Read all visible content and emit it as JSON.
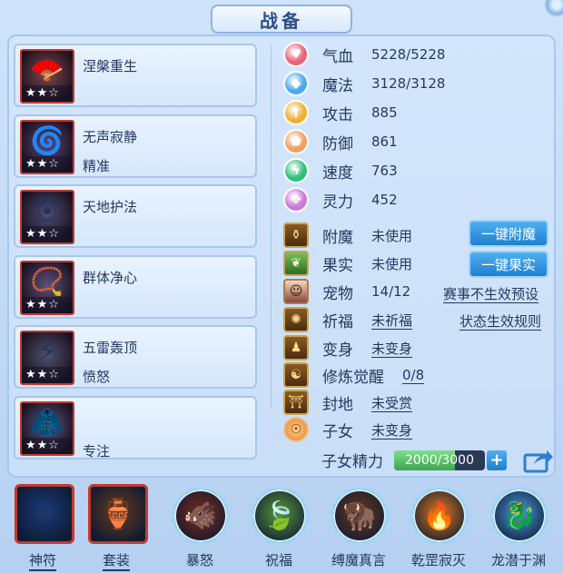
{
  "window": {
    "title": "战备"
  },
  "skills": [
    {
      "name": "涅槃重生",
      "sub": "",
      "stars": "★★☆",
      "icon": "fan-icon",
      "glyph": "🪭",
      "bg": "#6b1f1f"
    },
    {
      "name": "无声寂静",
      "sub": "精准",
      "stars": "★★☆",
      "icon": "silence-icon",
      "glyph": "🌀",
      "bg": "#3b1d4a"
    },
    {
      "name": "天地护法",
      "sub": "",
      "stars": "★★☆",
      "icon": "guardian-icon",
      "glyph": "👁",
      "bg": "#2f2450"
    },
    {
      "name": "群体净心",
      "sub": "",
      "stars": "★★☆",
      "icon": "purify-icon",
      "glyph": "📿",
      "bg": "#3a2a55"
    },
    {
      "name": "五雷轰顶",
      "sub": "愤怒",
      "stars": "★★☆",
      "icon": "thunder-icon",
      "glyph": "⚡",
      "bg": "#2a2a48"
    },
    {
      "name": "",
      "sub": "专注",
      "stars": "★★☆",
      "icon": "focus-icon",
      "glyph": "🧥",
      "bg": "#3a3168"
    }
  ],
  "stats": [
    {
      "label": "气血",
      "value": "5228/5228",
      "icon": "heart-icon",
      "glyph": "♥",
      "color": "#e8627a"
    },
    {
      "label": "魔法",
      "value": "3128/3128",
      "icon": "mana-icon",
      "glyph": "◆",
      "color": "#4aa8f0"
    },
    {
      "label": "攻击",
      "value": "885",
      "icon": "attack-icon",
      "glyph": "†",
      "color": "#f0b030"
    },
    {
      "label": "防御",
      "value": "861",
      "icon": "defense-icon",
      "glyph": "⬟",
      "color": "#f0a060"
    },
    {
      "label": "速度",
      "value": "763",
      "icon": "speed-icon",
      "glyph": "ϟ",
      "color": "#2ec07a"
    },
    {
      "label": "灵力",
      "value": "452",
      "icon": "spirit-icon",
      "glyph": "✥",
      "color": "#c77ad8"
    }
  ],
  "buffs": [
    {
      "label": "附魔",
      "value": "未使用",
      "icon": "enchant-icon",
      "glyph": "⚱",
      "underline": false
    },
    {
      "label": "果实",
      "value": "未使用",
      "icon": "fruit-icon",
      "glyph": "❦",
      "underline": false
    },
    {
      "label": "宠物",
      "value": "14/12",
      "icon": "pet-icon",
      "glyph": "☺",
      "underline": false
    },
    {
      "label": "祈福",
      "value": "未祈福",
      "icon": "blessing-icon",
      "glyph": "✺",
      "underline": true
    },
    {
      "label": "变身",
      "value": "未变身",
      "icon": "transform-icon",
      "glyph": "♟",
      "underline": true
    },
    {
      "label": "修炼觉醒",
      "value": "0/8",
      "icon": "cultivate-icon",
      "glyph": "☯",
      "underline": true
    },
    {
      "label": "封地",
      "value": "未受赏",
      "icon": "fief-icon",
      "glyph": "⛩",
      "underline": true
    },
    {
      "label": "子女",
      "value": "未变身",
      "icon": "child-icon",
      "glyph": "☉",
      "underline": true
    }
  ],
  "buttons": {
    "enchant_all": "一键附魔",
    "fruit_all": "一键果实"
  },
  "links": {
    "preset": "赛事不生效预设",
    "rules": "状态生效规则"
  },
  "essence": {
    "label": "子女精力",
    "value_text": "2000/3000",
    "fraction": 0.6667,
    "plus": "+"
  },
  "bottom": [
    {
      "label": "神符",
      "icon": "talisman-icon",
      "glyph": "✦",
      "shape": "square",
      "underline": true,
      "bg": "#1a3a7a"
    },
    {
      "label": "套装",
      "icon": "armor-set-icon",
      "glyph": "🏺",
      "shape": "square",
      "underline": true,
      "bg": "#6a3a1a"
    },
    {
      "label": "暴怒",
      "icon": "fury-icon",
      "glyph": "🐗",
      "shape": "round",
      "underline": false,
      "bg": "#7a2a1a"
    },
    {
      "label": "祝福",
      "icon": "bless-icon",
      "glyph": "🍃",
      "shape": "round",
      "underline": false,
      "bg": "#5a9a3a"
    },
    {
      "label": "缚魔真言",
      "icon": "bind-demon-icon",
      "glyph": "🦬",
      "shape": "round",
      "underline": false,
      "bg": "#6a3a1a"
    },
    {
      "label": "乾罡寂灭",
      "icon": "qiangang-icon",
      "glyph": "🔥",
      "shape": "round",
      "underline": false,
      "bg": "#e07a1a"
    },
    {
      "label": "龙潜于渊",
      "icon": "dragon-icon",
      "glyph": "🐉",
      "shape": "round",
      "underline": false,
      "bg": "#4aa0e0"
    }
  ]
}
